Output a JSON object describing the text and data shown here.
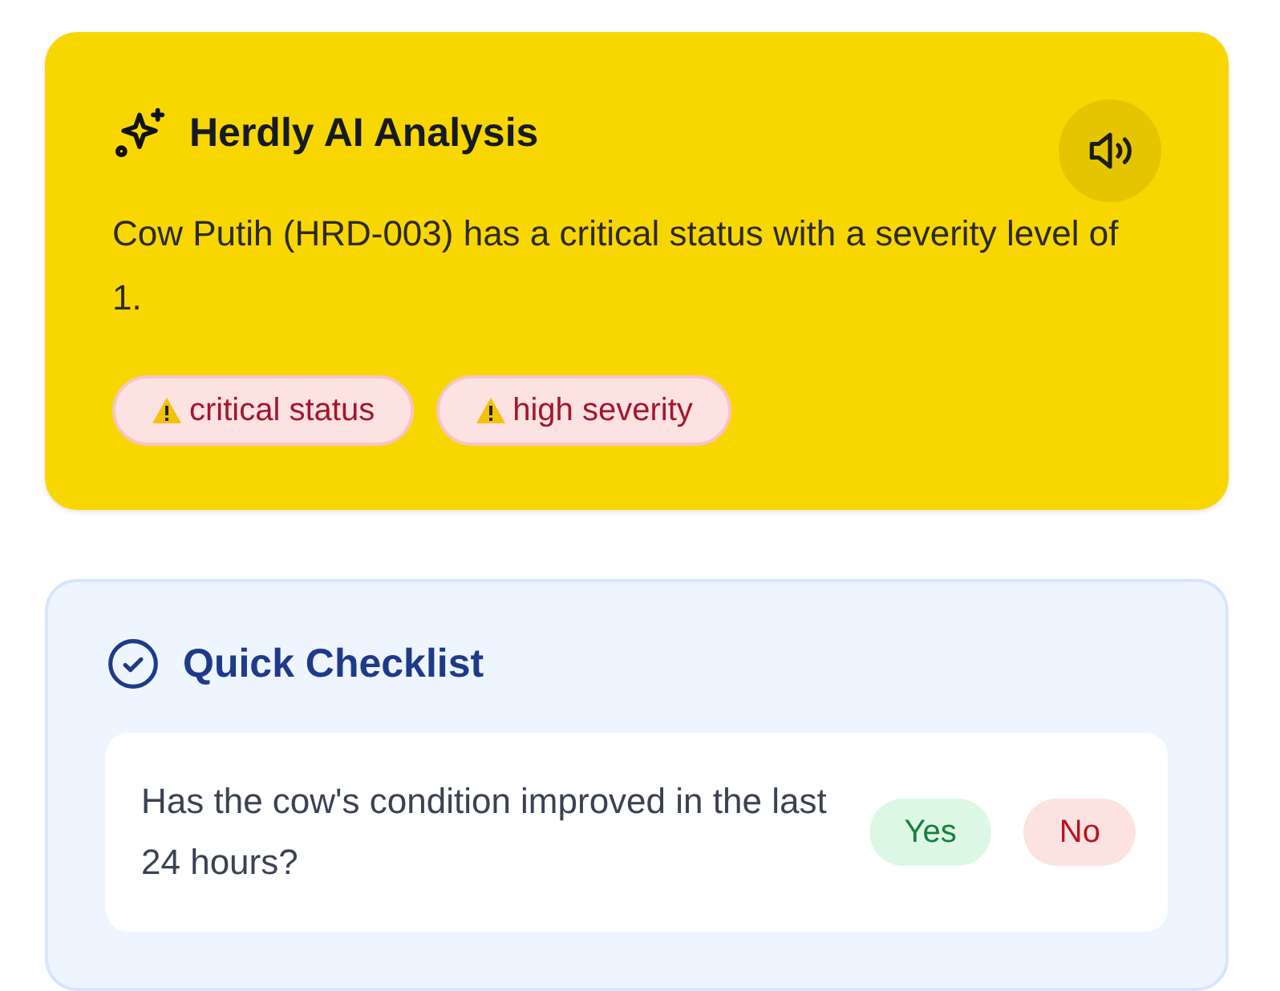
{
  "analysis": {
    "title": "Herdly AI Analysis",
    "summary": "Cow Putih (HRD-003) has a critical status with a severity level of 1.",
    "tags": [
      {
        "label": "critical status",
        "kind": "warning"
      },
      {
        "label": "high severity",
        "kind": "warning"
      }
    ]
  },
  "checklist": {
    "title": "Quick Checklist",
    "items": [
      {
        "question": "Has the cow's condition improved in the last 24 hours?",
        "answers": [
          {
            "label": "Yes",
            "kind": "yes"
          },
          {
            "label": "No",
            "kind": "no"
          }
        ]
      }
    ]
  }
}
